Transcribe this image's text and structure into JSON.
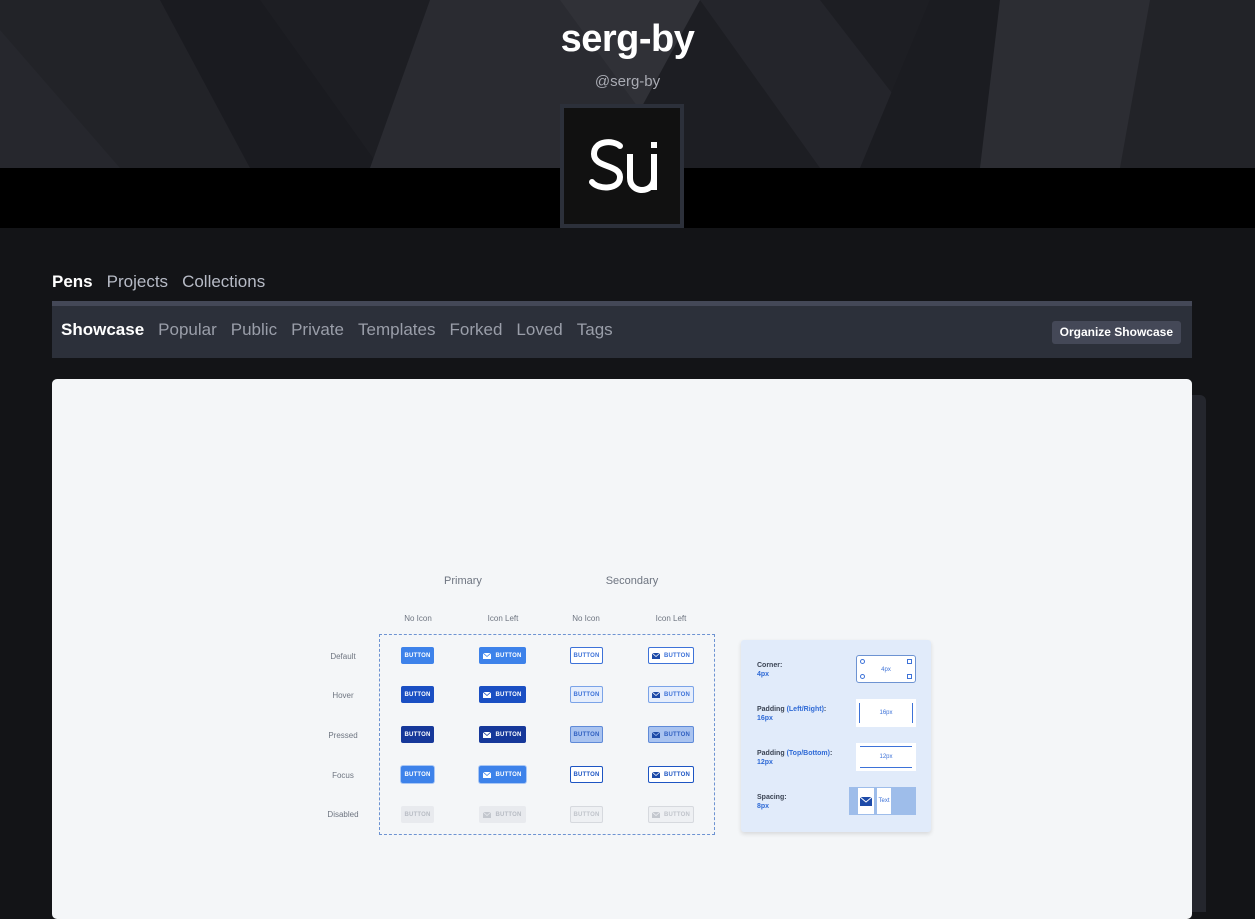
{
  "profile": {
    "name": "serg-by",
    "handle": "@serg-by",
    "avatar_text": "SU"
  },
  "main_tabs": [
    {
      "label": "Pens",
      "active": true
    },
    {
      "label": "Projects",
      "active": false
    },
    {
      "label": "Collections",
      "active": false
    }
  ],
  "sub_tabs": [
    {
      "label": "Showcase",
      "active": true
    },
    {
      "label": "Popular",
      "active": false
    },
    {
      "label": "Public",
      "active": false
    },
    {
      "label": "Private",
      "active": false
    },
    {
      "label": "Templates",
      "active": false
    },
    {
      "label": "Forked",
      "active": false
    },
    {
      "label": "Loved",
      "active": false
    },
    {
      "label": "Tags",
      "active": false
    }
  ],
  "organize_label": "Organize Showcase",
  "preview": {
    "groups": [
      "Primary",
      "Secondary"
    ],
    "columns": [
      "No Icon",
      "Icon Left",
      "No Icon",
      "Icon Left"
    ],
    "rows": [
      "Default",
      "Hover",
      "Pressed",
      "Focus",
      "Disabled"
    ],
    "button_label": "BUTTON",
    "specs": {
      "corner": {
        "label": "Corner:",
        "value": "4px",
        "box_text": "4px"
      },
      "padding_lr": {
        "label": "Padding",
        "hl": "(Left/Right)",
        "suffix": ":",
        "value": "16px",
        "box_text": "16px"
      },
      "padding_tb": {
        "label": "Padding",
        "hl": "(Top/Bottom)",
        "suffix": ":",
        "value": "12px",
        "box_text": "12px"
      },
      "spacing": {
        "label": "Spacing:",
        "value": "8px",
        "box_text": "Text"
      }
    }
  },
  "colors": {
    "background": "#131417",
    "header": "#1e1f25",
    "subnav": "#2c303a",
    "primary_blue": "#3d82ea",
    "preview_bg": "#f4f6f8"
  }
}
